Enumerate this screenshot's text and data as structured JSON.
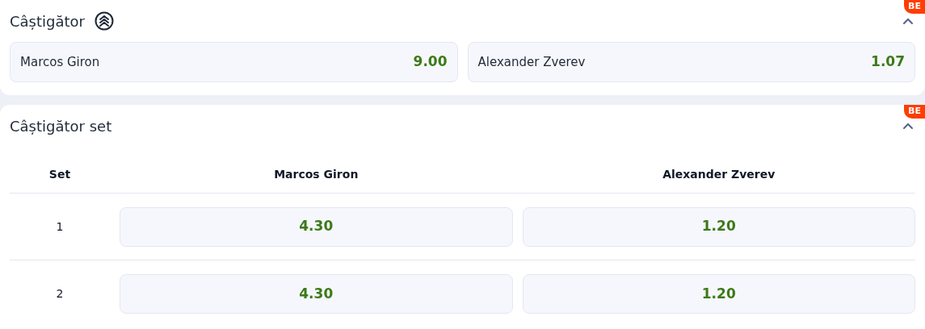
{
  "markets": [
    {
      "kind": "winner",
      "title": "Câștigător",
      "badge": "BE",
      "expanded": true,
      "outcomes": [
        {
          "name": "Marcos Giron",
          "odd": "9.00"
        },
        {
          "name": "Alexander Zverev",
          "odd": "1.07"
        }
      ]
    },
    {
      "kind": "set_winner",
      "title": "Câștigător set",
      "badge": "BE",
      "expanded": true,
      "columns": [
        "Set",
        "Marcos Giron",
        "Alexander Zverev"
      ],
      "rows": [
        {
          "set": "1",
          "odds": [
            "4.30",
            "1.20"
          ]
        },
        {
          "set": "2",
          "odds": [
            "4.30",
            "1.20"
          ]
        }
      ]
    }
  ]
}
